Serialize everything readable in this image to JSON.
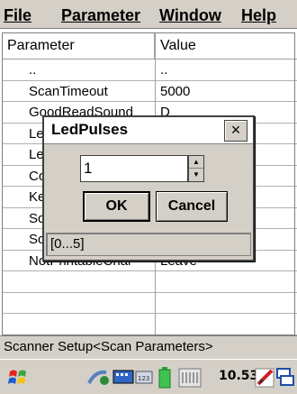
{
  "menu": {
    "file": "File",
    "parameter": "Parameter",
    "window": "Window",
    "help": "Help"
  },
  "table": {
    "columns": [
      "Parameter",
      "Value"
    ],
    "rows": [
      {
        "param": "..",
        "value": ".."
      },
      {
        "param": "ScanTimeout",
        "value": "5000"
      },
      {
        "param": "GoodReadSound",
        "value": "D"
      },
      {
        "param": "LedPulses",
        "value": ""
      },
      {
        "param": "LedPulseTime",
        "value": ""
      },
      {
        "param": "CodeMode",
        "value": ""
      },
      {
        "param": "KeyboardWedge",
        "value": ""
      },
      {
        "param": "ScanSuffix",
        "value": ""
      },
      {
        "param": "ScanPrefix",
        "value": ""
      },
      {
        "param": "NotPrintableChar",
        "value": "Leave"
      },
      {
        "param": "",
        "value": ""
      },
      {
        "param": "",
        "value": ""
      },
      {
        "param": "",
        "value": ""
      },
      {
        "param": "",
        "value": ""
      }
    ]
  },
  "status_text": "Scanner Setup<Scan Parameters>",
  "taskbar": {
    "clock": "10.53",
    "icons": [
      "start-windows-icon",
      "connectivity-icon",
      "input-panel-icon",
      "battery-icon",
      "signal-icon",
      "edit-icon",
      "window-switch-icon"
    ]
  },
  "dialog": {
    "title": "LedPulses",
    "close_label": "×",
    "value": "1",
    "ok_label": "OK",
    "cancel_label": "Cancel",
    "range": "[0...5]"
  }
}
